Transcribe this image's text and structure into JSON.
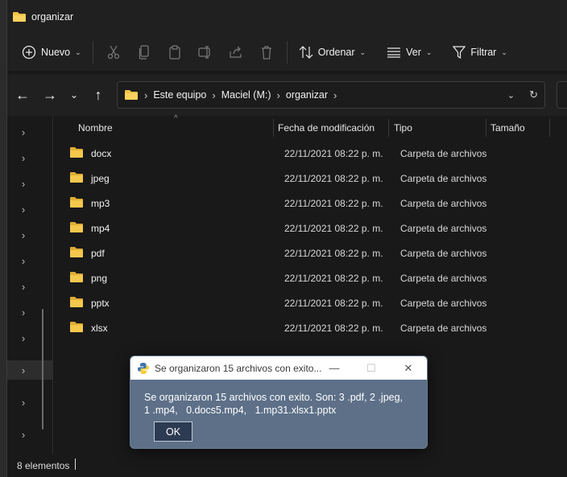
{
  "window": {
    "title": "organizar"
  },
  "toolbar": {
    "new_label": "Nuevo",
    "sort_label": "Ordenar",
    "view_label": "Ver",
    "filter_label": "Filtrar"
  },
  "address": {
    "crumbs": [
      "Este equipo",
      "Maciel (M:)",
      "organizar"
    ]
  },
  "columns": {
    "name": "Nombre",
    "date": "Fecha de modificación",
    "type": "Tipo",
    "size": "Tamaño"
  },
  "rows": [
    {
      "name": "docx",
      "date": "22/11/2021 08:22 p. m.",
      "type": "Carpeta de archivos"
    },
    {
      "name": "jpeg",
      "date": "22/11/2021 08:22 p. m.",
      "type": "Carpeta de archivos"
    },
    {
      "name": "mp3",
      "date": "22/11/2021 08:22 p. m.",
      "type": "Carpeta de archivos"
    },
    {
      "name": "mp4",
      "date": "22/11/2021 08:22 p. m.",
      "type": "Carpeta de archivos"
    },
    {
      "name": "pdf",
      "date": "22/11/2021 08:22 p. m.",
      "type": "Carpeta de archivos"
    },
    {
      "name": "png",
      "date": "22/11/2021 08:22 p. m.",
      "type": "Carpeta de archivos"
    },
    {
      "name": "pptx",
      "date": "22/11/2021 08:22 p. m.",
      "type": "Carpeta de archivos"
    },
    {
      "name": "xlsx",
      "date": "22/11/2021 08:22 p. m.",
      "type": "Carpeta de archivos"
    }
  ],
  "status": {
    "count": "8 elementos"
  },
  "dialog": {
    "title": "Se organizaron 15 archivos con exito...",
    "message_line1": "Se organizaron 15 archivos con exito. Son: 3 .pdf, 2 .jpeg,",
    "message_line2": "1 .mp4,   0.docs5.mp4,   1.mp31.xlsx1.pptx",
    "ok_label": "OK"
  },
  "colors": {
    "folder": "#f1c24a",
    "dialog_bg": "#5d7088",
    "window_bg": "#191919"
  },
  "icons": {
    "new": "plus-circle-icon",
    "cut": "scissors-icon",
    "copy": "copy-icon",
    "paste": "paste-icon",
    "rename": "rename-icon",
    "share": "share-icon",
    "delete": "trash-icon",
    "sort": "sort-icon",
    "view": "view-list-icon",
    "filter": "filter-icon",
    "back": "arrow-left-icon",
    "forward": "arrow-right-icon",
    "up": "arrow-up-icon",
    "refresh": "refresh-icon",
    "python": "python-icon"
  }
}
